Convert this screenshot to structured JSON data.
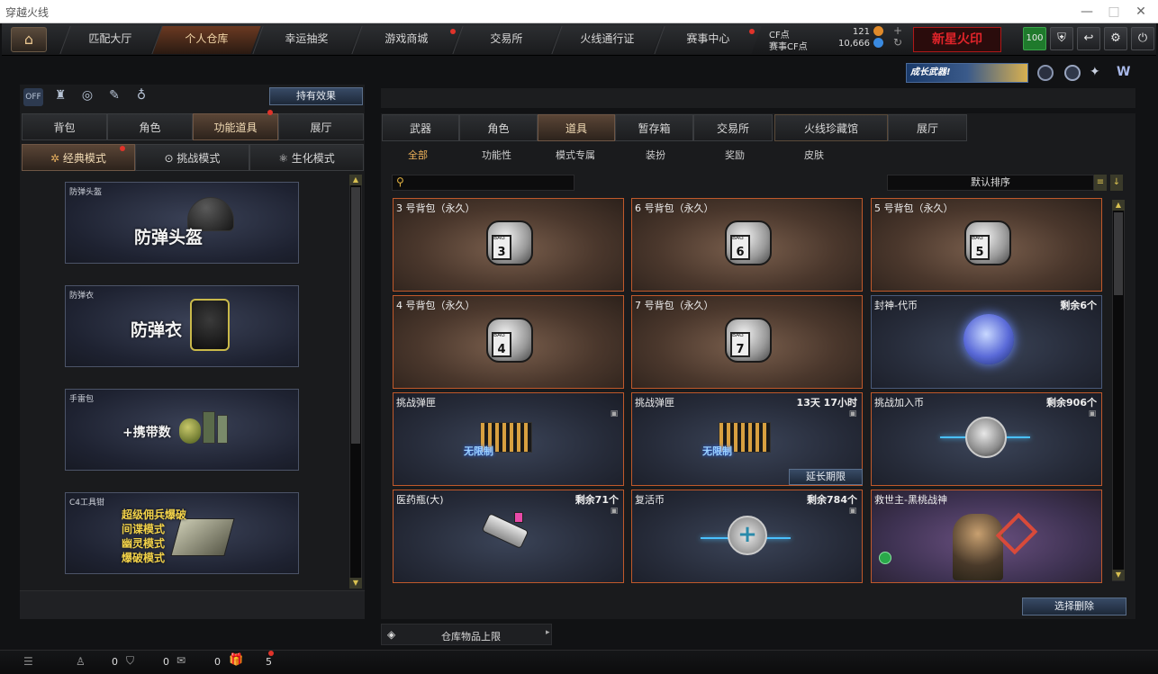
{
  "window": {
    "title": "穿越火线",
    "minimize": "—",
    "maximize": "□",
    "close": "✕"
  },
  "nav": {
    "tabs": [
      {
        "label": "匹配大厅",
        "active": false,
        "dot": false
      },
      {
        "label": "个人仓库",
        "active": true,
        "dot": false
      },
      {
        "label": "幸运抽奖",
        "active": false,
        "dot": false
      },
      {
        "label": "游戏商城",
        "active": false,
        "dot": true
      },
      {
        "label": "交易所",
        "active": false,
        "dot": false
      },
      {
        "label": "火线通行证",
        "active": false,
        "dot": false
      },
      {
        "label": "赛事中心",
        "active": false,
        "dot": true
      }
    ],
    "currency": {
      "cf_label": "CF点",
      "cf_value": "121",
      "event_cf_label": "赛事CF点",
      "event_cf_value": "10,666"
    },
    "banner_text": "新星火印",
    "level_badge": "100",
    "growth_banner": "成长武器!"
  },
  "left": {
    "hold_effect": "持有效果",
    "icons_off": "OFF",
    "tabs": [
      {
        "label": "背包",
        "active": false
      },
      {
        "label": "角色",
        "active": false
      },
      {
        "label": "功能道具",
        "active": true
      },
      {
        "label": "展厅",
        "active": false
      }
    ],
    "modes": [
      {
        "label": "经典模式",
        "active": true
      },
      {
        "label": "挑战模式",
        "active": false
      },
      {
        "label": "生化模式",
        "active": false
      }
    ],
    "cards": [
      {
        "label": "防弹头盔",
        "big": "防弹头盔"
      },
      {
        "label": "防弹衣",
        "big": "防弹衣"
      },
      {
        "label": "手雷包",
        "big": "+携带数"
      },
      {
        "label": "C4工具钳",
        "big_lines": [
          "超级佣兵爆破",
          "间谍模式",
          "幽灵模式",
          "爆破模式"
        ]
      }
    ]
  },
  "right": {
    "tabs": [
      {
        "label": "武器",
        "active": false
      },
      {
        "label": "角色",
        "active": false
      },
      {
        "label": "道具",
        "active": true
      },
      {
        "label": "暂存箱",
        "active": false
      },
      {
        "label": "交易所",
        "active": false
      },
      {
        "label": "火线珍藏馆",
        "active": false
      },
      {
        "label": "展厅",
        "active": false
      }
    ],
    "subtabs": [
      {
        "label": "全部",
        "active": true
      },
      {
        "label": "功能性",
        "active": false
      },
      {
        "label": "模式专属",
        "active": false
      },
      {
        "label": "装扮",
        "active": false
      },
      {
        "label": "奖励",
        "active": false
      },
      {
        "label": "皮肤",
        "active": false
      }
    ],
    "search_placeholder": "",
    "sort_label": "默认排序",
    "items": [
      {
        "name": "3 号背包（永久）",
        "remaining": "",
        "type": "bag",
        "num": "3"
      },
      {
        "name": "6 号背包（永久）",
        "remaining": "",
        "type": "bag",
        "num": "6"
      },
      {
        "name": "5 号背包（永久）",
        "remaining": "",
        "type": "bag",
        "num": "5"
      },
      {
        "name": "4 号背包（永久）",
        "remaining": "",
        "type": "bag",
        "num": "4"
      },
      {
        "name": "7 号背包（永久）",
        "remaining": "",
        "type": "bag",
        "num": "7"
      },
      {
        "name": "封神-代币",
        "remaining": "剩余6个",
        "type": "coin"
      },
      {
        "name": "挑战弹匣",
        "remaining": "",
        "type": "ammo",
        "badge": "无限制"
      },
      {
        "name": "挑战弹匣",
        "remaining": "13天 17小时",
        "type": "ammo",
        "badge": "无限制",
        "extend": "延长期限"
      },
      {
        "name": "挑战加入币",
        "remaining": "剩余906个",
        "type": "join"
      },
      {
        "name": "医药瓶(大)",
        "remaining": "剩余71个",
        "type": "med"
      },
      {
        "name": "复活币",
        "remaining": "剩余784个",
        "type": "revive"
      },
      {
        "name": "救世主-黑桃战神",
        "remaining": "",
        "type": "char"
      }
    ],
    "select_delete": "选择删除",
    "storage_limit": "仓库物品上限"
  },
  "bottom": {
    "counts": [
      "0",
      "0",
      "0",
      "5"
    ]
  },
  "colors": {
    "accent_orange": "#c0592b",
    "active_text": "#f0b35a",
    "scroll_yellow": "#d8c050"
  }
}
